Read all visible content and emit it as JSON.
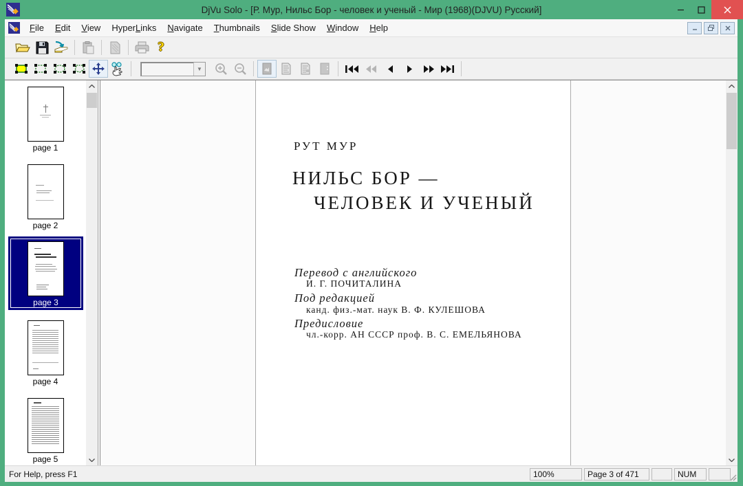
{
  "window": {
    "app_name": "DjVu Solo",
    "title": "DjVu Solo - [Р. Мур, Нильс Бор - человек и ученый - Мир (1968)(DJVU) Русский]"
  },
  "colors": {
    "titlebar_green": "#4FAE7F",
    "close_button_red": "#E15151",
    "selection_navy": "#000080",
    "toolbar_gray": "#F1F1F1"
  },
  "menu": {
    "items": [
      {
        "pre": "",
        "key": "F",
        "post": "ile"
      },
      {
        "pre": "",
        "key": "E",
        "post": "dit"
      },
      {
        "pre": "",
        "key": "V",
        "post": "iew"
      },
      {
        "pre": "Hyper",
        "key": "L",
        "post": "inks"
      },
      {
        "pre": "",
        "key": "N",
        "post": "avigate"
      },
      {
        "pre": "",
        "key": "T",
        "post": "humbnails"
      },
      {
        "pre": "",
        "key": "S",
        "post": "lide Show"
      },
      {
        "pre": "",
        "key": "W",
        "post": "indow"
      },
      {
        "pre": "",
        "key": "H",
        "post": "elp"
      }
    ]
  },
  "toolbar_standard": {
    "buttons": [
      "open-folder-icon",
      "save-floppy-icon",
      "djvu-import-icon",
      "paste-icon",
      "document-icon",
      "print-icon",
      "help-icon"
    ],
    "help_glyph": "?"
  },
  "toolbar_view": {
    "buttons": [
      "select-rect-filled-icon",
      "select-rect-icon",
      "select-ellipse-icon",
      "select-polygon-icon",
      "pan-icon",
      "hyperlink-hand-icon",
      "zoom-in-icon",
      "zoom-out-icon",
      "page-mode-icons",
      "nav-first-icon",
      "nav-prev-fast-icon",
      "nav-prev-icon",
      "nav-next-icon",
      "nav-next-fast-icon",
      "nav-last-icon"
    ],
    "zoom_combo_value": "",
    "active_tool": "pan"
  },
  "thumbnails": {
    "selected_index": 2,
    "items": [
      {
        "label": "page 1"
      },
      {
        "label": "page 2"
      },
      {
        "label": "page 3"
      },
      {
        "label": "page 4"
      },
      {
        "label": "page 5"
      }
    ]
  },
  "document_page": {
    "author": "РУТ МУР",
    "title_line1": "НИЛЬС БОР —",
    "title_line2": "ЧЕЛОВЕК И УЧЕНЫЙ",
    "credits": [
      {
        "role": "Перевод с английского",
        "name": "И. Г. ПОЧИТАЛИНА"
      },
      {
        "role": "Под редакцией",
        "name": "канд. физ.-мат. наук В. Ф. КУЛЕШОВА"
      },
      {
        "role": "Предисловие",
        "name": "чл.-корр. АН СССР проф. В. С. ЕМЕЛЬЯНОВА"
      }
    ]
  },
  "statusbar": {
    "help_text": "For Help, press F1",
    "zoom_level": "100%",
    "page_indicator": "Page 3 of 471",
    "keyboard_state": "NUM"
  }
}
